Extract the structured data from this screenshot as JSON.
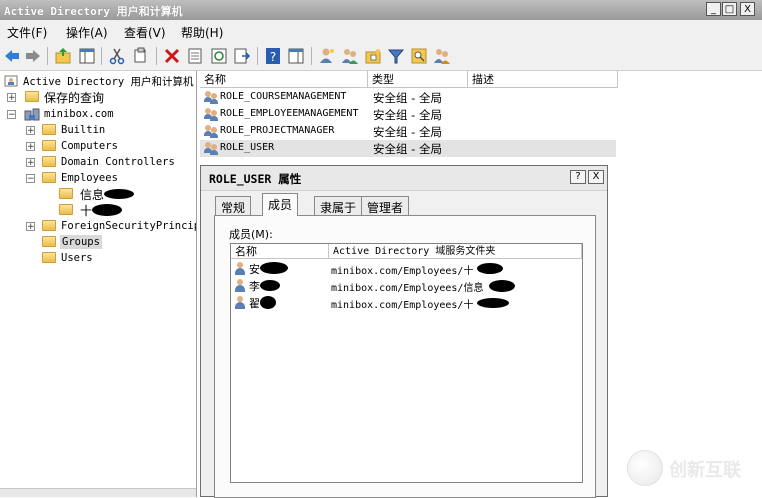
{
  "window": {
    "title": "Active Directory 用户和计算机",
    "min": "_",
    "max": "□",
    "close": "X"
  },
  "menu": [
    "文件(F)",
    "操作(A)",
    "查看(V)",
    "帮助(H)"
  ],
  "tree": {
    "root": "Active Directory 用户和计算机",
    "saved_queries": "保存的查询",
    "domain": "minibox.com",
    "builtin": "Builtin",
    "computers": "Computers",
    "domain_controllers": "Domain Controllers",
    "employees": "Employees",
    "sub1": "信息",
    "sub2": "十",
    "foreign": "ForeignSecurityPrincip",
    "groups": "Groups",
    "users": "Users"
  },
  "list": {
    "columns": [
      "名称",
      "类型",
      "描述"
    ],
    "rows": [
      {
        "name": "ROLE_COURSEMANAGEMENT",
        "type": "安全组 - 全局"
      },
      {
        "name": "ROLE_EMPLOYEEMANAGEMENT",
        "type": "安全组 - 全局"
      },
      {
        "name": "ROLE_PROJECTMANAGER",
        "type": "安全组 - 全局"
      },
      {
        "name": "ROLE_USER",
        "type": "安全组 - 全局"
      }
    ]
  },
  "dialog": {
    "title": "ROLE_USER 属性",
    "help": "?",
    "close": "X",
    "tabs": [
      "常规",
      "成员",
      "隶属于",
      "管理者"
    ],
    "members_label": "成员(M):",
    "columns": [
      "名称",
      "Active Directory 域服务文件夹"
    ],
    "members": [
      {
        "name": "安",
        "folder": "minibox.com/Employees/十"
      },
      {
        "name": "李",
        "folder": "minibox.com/Employees/信息"
      },
      {
        "name": "翟",
        "folder": "minibox.com/Employees/十"
      }
    ]
  },
  "watermark": "创新互联"
}
